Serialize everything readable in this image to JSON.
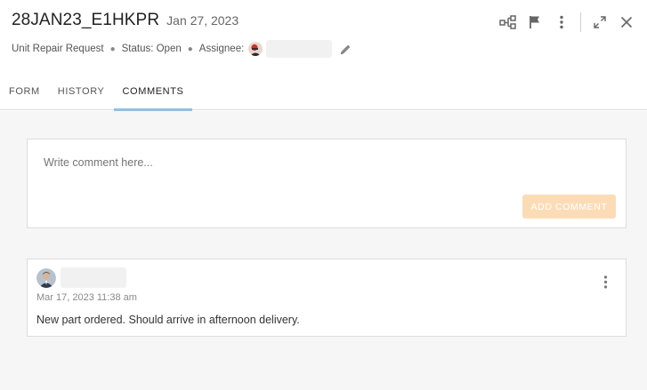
{
  "ticket": {
    "id": "28JAN23_E1HKPR",
    "date": "Jan 27, 2023",
    "type": "Unit Repair Request",
    "status": "Status: Open",
    "assignee_label": "Assignee:",
    "assignee_name": ""
  },
  "toolbar": {
    "icons": [
      "workflow-icon",
      "flag-icon",
      "more-vertical-icon",
      "expand-icon",
      "close-icon"
    ]
  },
  "tabs": [
    {
      "label": "FORM",
      "active": false
    },
    {
      "label": "HISTORY",
      "active": false
    },
    {
      "label": "COMMENTS",
      "active": true
    }
  ],
  "composer": {
    "placeholder": "Write comment here...",
    "button_label": "ADD COMMENT"
  },
  "comments": [
    {
      "author": "",
      "timestamp": "Mar 17, 2023 11:38 am",
      "text": "New part ordered. Should arrive in afternoon delivery."
    }
  ],
  "colors": {
    "tab_indicator": "#8ec1e3",
    "add_button_bg": "#fcdcb6",
    "content_bg": "#f6f6f6"
  }
}
